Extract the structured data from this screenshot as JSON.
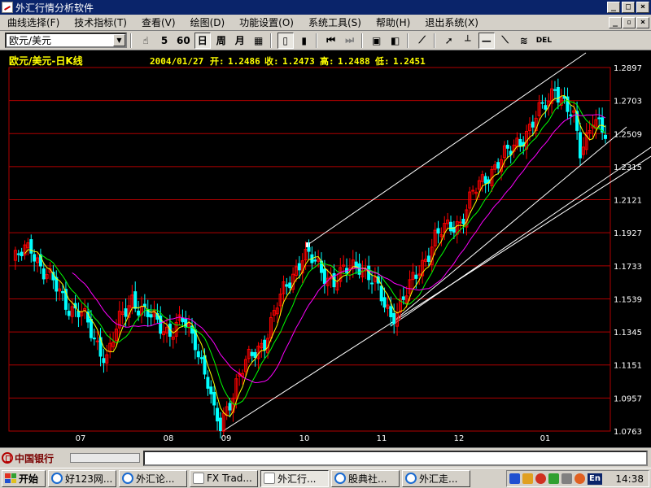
{
  "window": {
    "title": "外汇行情分析软件"
  },
  "menu": [
    "曲线选择(F)",
    "技术指标(T)",
    "查看(V)",
    "绘图(D)",
    "功能设置(O)",
    "系统工具(S)",
    "帮助(H)",
    "退出系统(X)"
  ],
  "toolbar": {
    "symbol": "欧元/美元",
    "period_5": "5",
    "period_60": "60",
    "day": "日",
    "week": "周",
    "month": "月",
    "del": "DEL"
  },
  "colors": {
    "candle_up": "#ff0000",
    "candle_down": "#00ffff",
    "ma_short": "#ffff00",
    "ma_mid": "#00ff00",
    "ma_long": "#ff00ff",
    "grid": "#b00000",
    "trendline": "#ffffff"
  },
  "chart_data": {
    "type": "candlestick",
    "title": "欧元/美元-日K线",
    "info": {
      "date": "2004/01/27",
      "open_label": "开:",
      "open": "1.2486",
      "close_label": "收:",
      "close": "1.2473",
      "high_label": "高:",
      "high": "1.2488",
      "low_label": "低:",
      "low": "1.2451"
    },
    "y_ticks": [
      "1.2897",
      "1.2703",
      "1.2509",
      "1.2315",
      "1.2121",
      "1.1927",
      "1.1733",
      "1.1539",
      "1.1345",
      "1.1151",
      "1.0957",
      "1.0763"
    ],
    "ylim": [
      1.0763,
      1.2897
    ],
    "x_ticks": [
      "07",
      "08",
      "09",
      "10",
      "11",
      "12",
      "01"
    ],
    "grid": "horizontal",
    "series": [
      {
        "type": "candles"
      },
      {
        "type": "line"
      },
      {
        "type": "line"
      },
      {
        "type": "line"
      }
    ],
    "anchors": [
      [
        0,
        1.175
      ],
      [
        6,
        1.185
      ],
      [
        10,
        1.17
      ],
      [
        14,
        1.16
      ],
      [
        18,
        1.15
      ],
      [
        22,
        1.145
      ],
      [
        26,
        1.13
      ],
      [
        30,
        1.12
      ],
      [
        34,
        1.14
      ],
      [
        38,
        1.155
      ],
      [
        42,
        1.145
      ],
      [
        46,
        1.14
      ],
      [
        50,
        1.135
      ],
      [
        54,
        1.14
      ],
      [
        58,
        1.13
      ],
      [
        62,
        1.105
      ],
      [
        64,
        1.085
      ],
      [
        66,
        1.078
      ],
      [
        68,
        1.09
      ],
      [
        72,
        1.11
      ],
      [
        76,
        1.12
      ],
      [
        80,
        1.13
      ],
      [
        84,
        1.15
      ],
      [
        88,
        1.165
      ],
      [
        92,
        1.18
      ],
      [
        94,
        1.178
      ],
      [
        98,
        1.17
      ],
      [
        102,
        1.165
      ],
      [
        106,
        1.17
      ],
      [
        110,
        1.175
      ],
      [
        114,
        1.165
      ],
      [
        118,
        1.15
      ],
      [
        120,
        1.145
      ],
      [
        122,
        1.148
      ],
      [
        126,
        1.16
      ],
      [
        130,
        1.175
      ],
      [
        134,
        1.19
      ],
      [
        138,
        1.195
      ],
      [
        142,
        1.2
      ],
      [
        146,
        1.215
      ],
      [
        150,
        1.225
      ],
      [
        154,
        1.235
      ],
      [
        158,
        1.24
      ],
      [
        162,
        1.25
      ],
      [
        166,
        1.26
      ],
      [
        170,
        1.27
      ],
      [
        172,
        1.28
      ],
      [
        174,
        1.272
      ],
      [
        176,
        1.265
      ],
      [
        178,
        1.258
      ],
      [
        180,
        1.24
      ],
      [
        182,
        1.25
      ],
      [
        184,
        1.262
      ],
      [
        186,
        1.255
      ],
      [
        188,
        1.248
      ]
    ]
  },
  "statusbar": {
    "bank": "中国银行"
  },
  "taskbar": {
    "start": "开始",
    "buttons": [
      "好123网...",
      "外汇论...",
      "FX Trad...",
      "外汇行...",
      "股典社...",
      "外汇走..."
    ],
    "lang": "En",
    "clock": "14:38"
  }
}
